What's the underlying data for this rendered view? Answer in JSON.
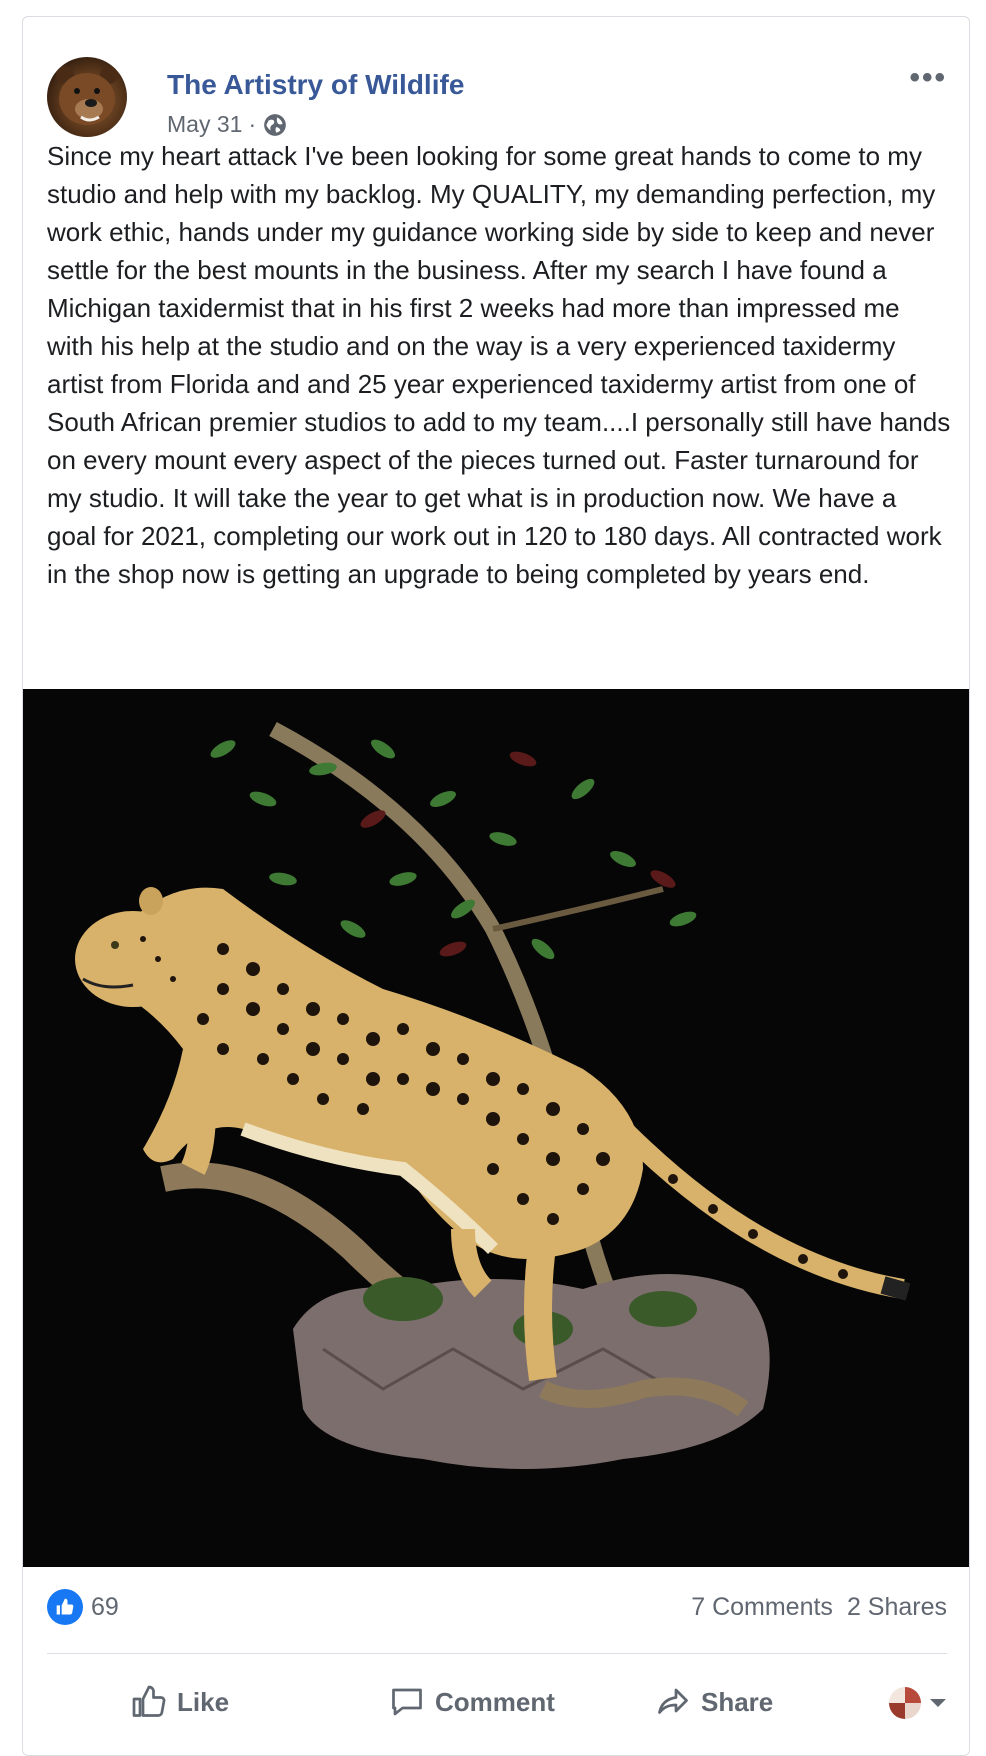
{
  "post": {
    "page_name": "The Artistry of Wildlife",
    "date": "May 31",
    "date_separator": "·",
    "privacy_icon": "globe-icon",
    "more_icon": "more-options-icon",
    "text": "Since my heart attack I've been looking for some great hands to come to my studio and help with my backlog. My QUALITY, my demanding perfection, my work ethic, hands under my guidance working side by side to keep and never settle for the best mounts in the business. After my search I have found a Michigan taxidermist that in his first 2 weeks had more than impressed me with his help at the studio and on the way is a very experienced taxidermy artist from Florida and and 25 year experienced taxidermy artist from one of South African premier studios to add to my team....I personally still have hands on every mount every aspect of the pieces turned out. Faster turnaround for my studio. It will take the year to get what is in production now. We have a goal for 2021, completing our work out in 120 to 180 days. All contracted work in the shop now is getting an upgrade to being completed by years end."
  },
  "reactions": {
    "like_count": "69",
    "comments": "7 Comments",
    "shares": "2 Shares"
  },
  "actions": {
    "like": "Like",
    "comment": "Comment",
    "share": "Share"
  },
  "colors": {
    "link_blue": "#385898",
    "like_blue": "#1877f2",
    "muted": "#606770"
  }
}
